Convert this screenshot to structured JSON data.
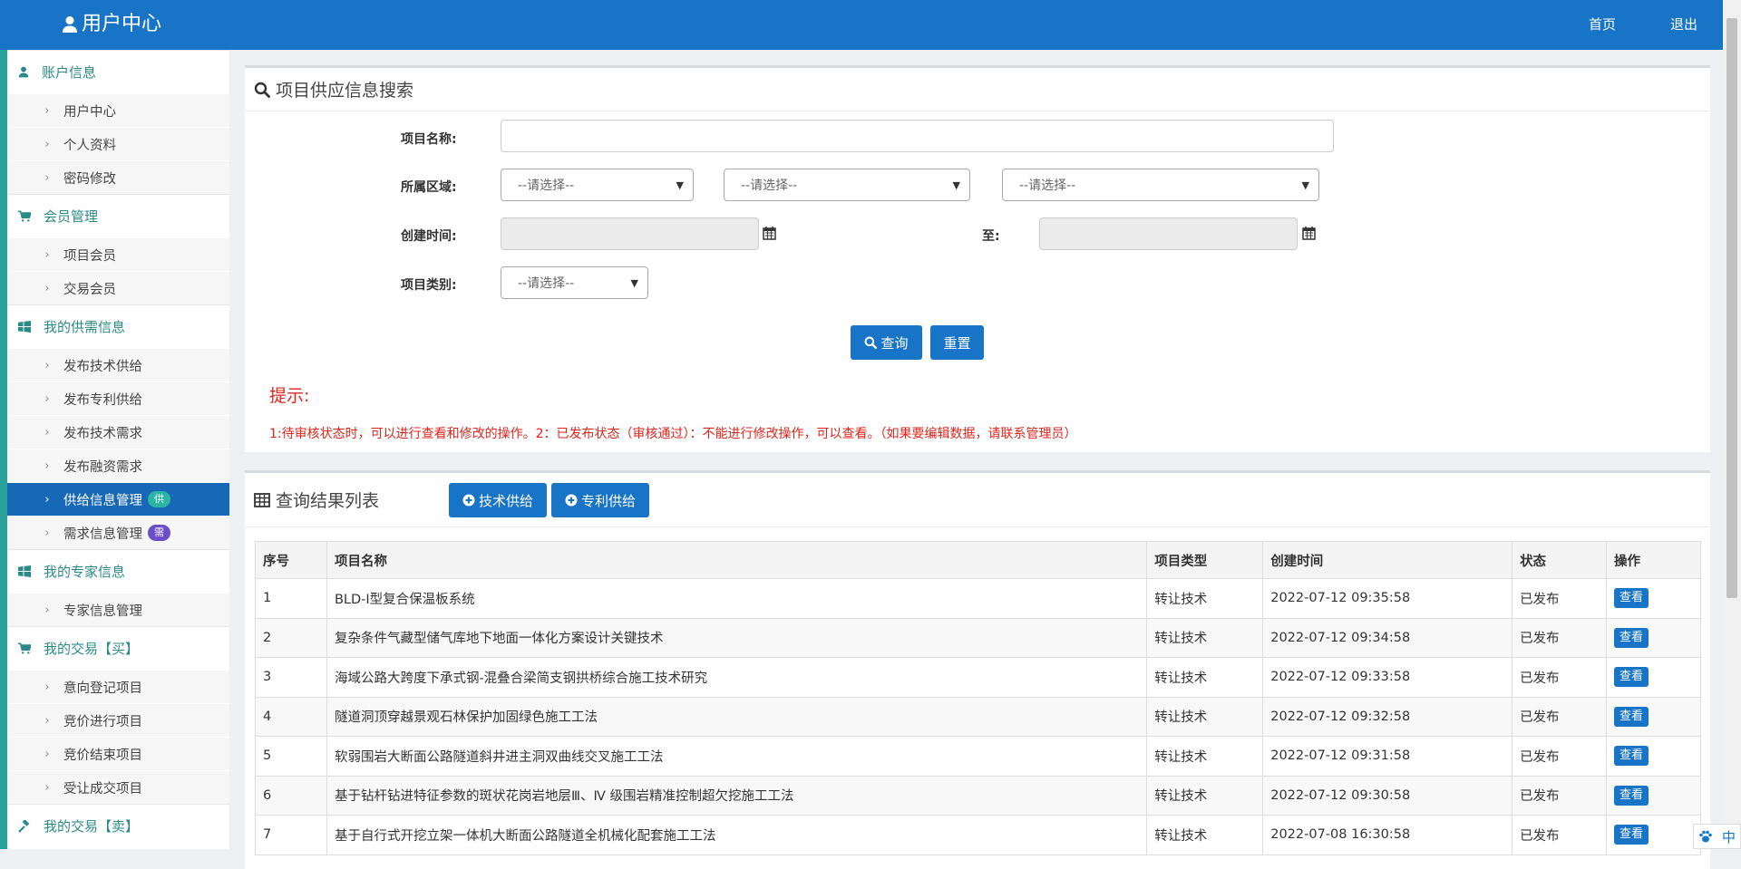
{
  "header": {
    "title": "用户中心",
    "nav": [
      "首页",
      "退出"
    ]
  },
  "sidebar": [
    {
      "section": "账户信息",
      "icon": "user-icon",
      "items": [
        {
          "label": "用户中心"
        },
        {
          "label": "个人资料"
        },
        {
          "label": "密码修改"
        }
      ]
    },
    {
      "section": "会员管理",
      "icon": "cart-icon",
      "items": [
        {
          "label": "项目会员"
        },
        {
          "label": "交易会员"
        }
      ]
    },
    {
      "section": "我的供需信息",
      "icon": "windows-icon",
      "items": [
        {
          "label": "发布技术供给"
        },
        {
          "label": "发布专利供给"
        },
        {
          "label": "发布技术需求"
        },
        {
          "label": "发布融资需求"
        },
        {
          "label": "供给信息管理",
          "badge": "供",
          "active": true
        },
        {
          "label": "需求信息管理",
          "badge": "需"
        }
      ]
    },
    {
      "section": "我的专家信息",
      "icon": "windows-icon",
      "items": [
        {
          "label": "专家信息管理"
        }
      ]
    },
    {
      "section": "我的交易【买】",
      "icon": "cart-icon",
      "items": [
        {
          "label": "意向登记项目"
        },
        {
          "label": "竞价进行项目"
        },
        {
          "label": "竞价结束项目"
        },
        {
          "label": "受让成交项目"
        }
      ]
    },
    {
      "section": "我的交易【卖】",
      "icon": "gavel-icon",
      "items": []
    }
  ],
  "search": {
    "title": "项目供应信息搜索",
    "name_label": "项目名称:",
    "name_value": "",
    "region_label": "所属区域:",
    "region_options": [
      "--请选择--",
      "--请选择--",
      "--请选择--"
    ],
    "time_label": "创建时间:",
    "to_label": "至:",
    "category_label": "项目类别:",
    "category_value": "--请选择--",
    "query_button": "查询",
    "reset_button": "重置",
    "tip_title": "提示:",
    "tip_text": "1:待审核状态时，可以进行查看和修改的操作。2：已发布状态（审核通过）：不能进行修改操作，可以查看。（如果要编辑数据，请联系管理员）"
  },
  "results": {
    "title": "查询结果列表",
    "buttons": [
      "技术供给",
      "专利供给"
    ],
    "columns": [
      "序号",
      "项目名称",
      "项目类型",
      "创建时间",
      "状态",
      "操作"
    ],
    "rows": [
      [
        "1",
        "BLD-I型复合保温板系统",
        "转让技术",
        "2022-07-12 09:35:58",
        "已发布",
        "查看"
      ],
      [
        "2",
        "复杂条件气藏型储气库地下地面一体化方案设计关键技术",
        "转让技术",
        "2022-07-12 09:34:58",
        "已发布",
        "查看"
      ],
      [
        "3",
        "海域公路大跨度下承式钢-混叠合梁简支钢拱桥综合施工技术研究",
        "转让技术",
        "2022-07-12 09:33:58",
        "已发布",
        "查看"
      ],
      [
        "4",
        "隧道洞顶穿越景观石林保护加固绿色施工工法",
        "转让技术",
        "2022-07-12 09:32:58",
        "已发布",
        "查看"
      ],
      [
        "5",
        "软弱围岩大断面公路隧道斜井进主洞双曲线交叉施工工法",
        "转让技术",
        "2022-07-12 09:31:58",
        "已发布",
        "查看"
      ],
      [
        "6",
        "基于钻杆钻进特征参数的斑状花岗岩地层Ⅲ、Ⅳ 级围岩精准控制超欠挖施工工法",
        "转让技术",
        "2022-07-12 09:30:58",
        "已发布",
        "查看"
      ],
      [
        "7",
        "基于自行式开挖立架一体机大断面公路隧道全机械化配套施工工法",
        "转让技术",
        "2022-07-08 16:30:58",
        "已发布",
        "查看"
      ]
    ]
  },
  "ime": {
    "label": "中"
  },
  "colors": {
    "primary": "#1874c6",
    "sidebar_accent": "#2a8a88",
    "tip": "#e0241b"
  }
}
